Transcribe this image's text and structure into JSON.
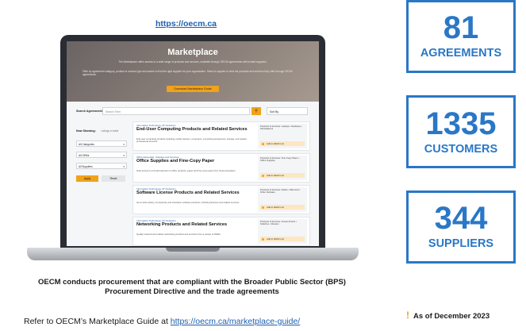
{
  "top_link": "https://oecm.ca",
  "marketplace": {
    "hero": {
      "title": "Marketplace",
      "text_1": "The Marketplace offers access to a wide range of products and services, available through OECM agreements with trusted suppliers.",
      "text_2": "Filter by agreement category, product or service type and search to find the right supplier for your organization. Select a supplier to view the products and services they offer through OECM agreements.",
      "button": "Download Marketplace Guide"
    },
    "search": {
      "label": "Search Agreements",
      "placeholder": "Search Term",
      "button_icon": "search-icon",
      "sort": "Sort By"
    },
    "filters": {
      "show_label": "Now Showing:",
      "show_value": "Listings in table",
      "selects": [
        "All Categories",
        "All OEMs",
        "All Suppliers"
      ],
      "apply": "Apply",
      "reset": "Reset"
    },
    "results": [
      {
        "category": "Information Technology (IT) Solutions",
        "title": "End-User Computing Products and Related Services",
        "desc": "End-user computing products including mobile devices, computers, computing accessories, storage, and related professional services.",
        "side_title": "Products & Services: Laptops • Desktops • Workstations",
        "side_btn": "Add to Watch List"
      },
      {
        "category": "Office Essentials, Supplies and Services",
        "title": "Office Supplies and Fine-Copy Paper",
        "desc": "Gain access to a broad selection of office products, paper and fine-copy paper from trusted suppliers.",
        "side_title": "Products & Services: Fine Copy Paper • Office Supplies",
        "side_btn": "Add to Watch List"
      },
      {
        "category": "Information Technology (IT) Solutions",
        "title": "Software License Products and Related Services",
        "desc": "Get a wide variety of enterprise and education software products, including licenses and related services.",
        "side_title": "Products & Services: Adobe • Microsoft • Other Software",
        "side_btn": "Add to Watch List"
      },
      {
        "category": "Information Technology (IT) Solutions",
        "title": "Networking Products and Related Services",
        "desc": "Quality network and related networking products and services from a variety of OEMs.",
        "side_title": "Products & Services: Access Points • Switches • Routers",
        "side_btn": "Add to Watch List"
      }
    ]
  },
  "caption": "OECM conducts procurement that are compliant with the Broader Public Sector (BPS) Procurement Directive and the trade agreements",
  "footer": {
    "prefix": "Refer to OECM’s Marketplace Guide at ",
    "link": "https://oecm.ca/marketplace-guide/"
  },
  "stats": [
    {
      "value": "81",
      "label": "AGREEMENTS"
    },
    {
      "value": "1335",
      "label": "CUSTOMERS"
    },
    {
      "value": "344",
      "label": "SUPPLIERS"
    }
  ],
  "as_of": {
    "mark": "!",
    "text": "As of December 2023"
  },
  "colors": {
    "accent_blue": "#2a77c6",
    "accent_orange": "#f0a21b",
    "link_blue": "#1f5fae"
  }
}
